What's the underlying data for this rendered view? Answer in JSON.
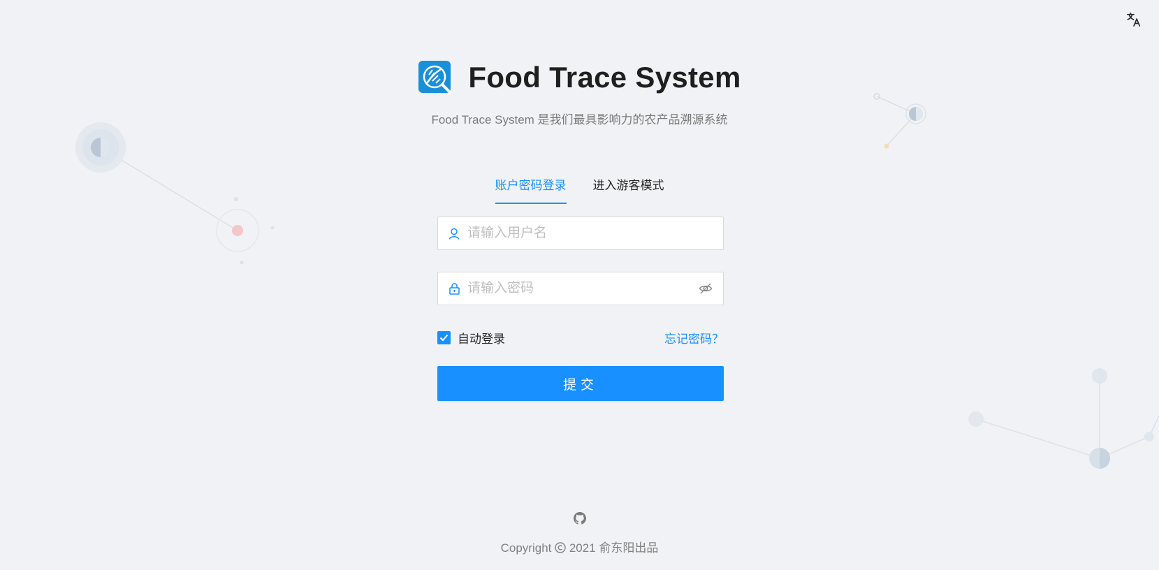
{
  "header": {
    "title": "Food Trace System",
    "subtitle": "Food Trace System 是我们最具影响力的农产品溯源系统"
  },
  "tabs": [
    {
      "label": "账户密码登录",
      "active": true
    },
    {
      "label": "进入游客模式",
      "active": false
    }
  ],
  "form": {
    "username_placeholder": "请输入用户名",
    "password_placeholder": "请输入密码",
    "auto_login_label": "自动登录",
    "auto_login_checked": true,
    "forgot_password": "忘记密码？",
    "submit_label": "提交"
  },
  "footer": {
    "copyright_prefix": "Copyright ",
    "copyright_text": " 2021 俞东阳出品"
  },
  "icons": {
    "language": "translate-icon",
    "github": "github-icon",
    "user": "user-icon",
    "lock": "lock-icon",
    "eye": "eye-invisible-icon"
  },
  "colors": {
    "primary": "#1890ff",
    "background": "#f0f2f5"
  }
}
